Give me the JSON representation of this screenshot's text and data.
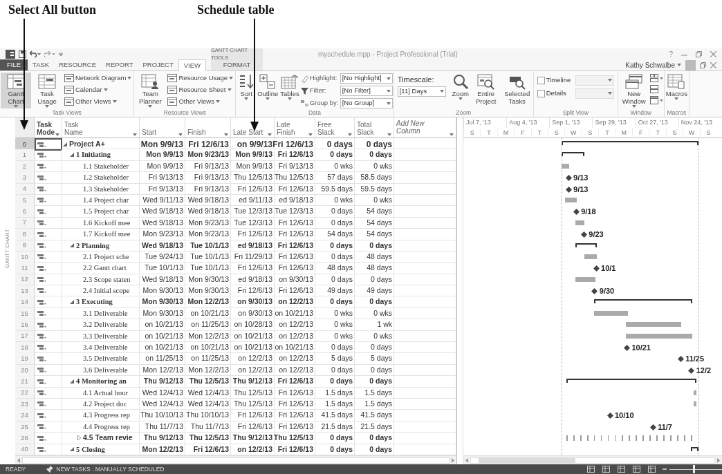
{
  "annotations": [
    {
      "text": "Select All button"
    },
    {
      "text": "Schedule table"
    }
  ],
  "title_bar": {
    "contextual": "GANTT CHART TOOLS",
    "title": "myschedule.mpp - Project Professional (Trial)",
    "help": "?"
  },
  "tabs": [
    {
      "label": "FILE",
      "kind": "file",
      "selected": false
    },
    {
      "label": "TASK",
      "kind": "tab",
      "selected": false
    },
    {
      "label": "RESOURCE",
      "kind": "tab",
      "selected": false
    },
    {
      "label": "REPORT",
      "kind": "tab",
      "selected": false
    },
    {
      "label": "PROJECT",
      "kind": "tab",
      "selected": false
    },
    {
      "label": "VIEW",
      "kind": "tab",
      "selected": true
    },
    {
      "label": "FORMAT",
      "kind": "contextual",
      "selected": false
    }
  ],
  "user": {
    "name": "Kathy Schwalbe"
  },
  "ribbon": [
    {
      "label": "Task Views",
      "columns": [
        {
          "kind": "large",
          "label": "Gantt Chart",
          "dropdown": true,
          "selected": true
        },
        {
          "kind": "large",
          "label": "Task Usage",
          "dropdown": true,
          "selected": false
        },
        {
          "kind": "stack",
          "items": [
            {
              "label": "Network Diagram",
              "dropdown": true,
              "selected": false
            },
            {
              "label": "Calendar",
              "dropdown": true,
              "selected": false
            },
            {
              "label": "Other Views",
              "dropdown": true,
              "selected": false
            }
          ]
        }
      ]
    },
    {
      "label": "Resource Views",
      "columns": [
        {
          "kind": "large",
          "label": "Team Planner",
          "dropdown": true,
          "selected": false
        },
        {
          "kind": "stack",
          "items": [
            {
              "label": "Resource Usage",
              "dropdown": true,
              "selected": false
            },
            {
              "label": "Resource Sheet",
              "dropdown": true,
              "selected": false
            },
            {
              "label": "Other Views",
              "dropdown": true,
              "selected": false
            }
          ]
        }
      ]
    },
    {
      "label": "Data",
      "columns": [
        {
          "kind": "large",
          "label": "Sort",
          "dropdown": true
        },
        {
          "kind": "large",
          "label": "Outline",
          "dropdown": true
        },
        {
          "kind": "large",
          "label": "Tables",
          "dropdown": true
        },
        {
          "kind": "fields",
          "items": [
            {
              "label": "Highlight:",
              "value": "[No Highlight]"
            },
            {
              "label": "Filter:",
              "value": "[No Filter]"
            },
            {
              "label": "Group by:",
              "value": "[No Group]"
            }
          ]
        }
      ]
    },
    {
      "label": "Zoom",
      "columns": [
        {
          "kind": "timescale",
          "label": "Timescale:",
          "value": "[11] Days"
        },
        {
          "kind": "large",
          "label": "Zoom",
          "dropdown": true
        },
        {
          "kind": "large",
          "label": "Entire Project",
          "dropdown": false
        },
        {
          "kind": "large",
          "label": "Selected Tasks",
          "dropdown": false
        }
      ]
    },
    {
      "label": "Split View",
      "columns": [
        {
          "kind": "checks",
          "items": [
            {
              "label": "Timeline",
              "checked": false
            },
            {
              "label": "Details",
              "checked": false
            }
          ]
        }
      ]
    },
    {
      "label": "Window",
      "columns": [
        {
          "kind": "large",
          "label": "New Window",
          "dropdown": true
        },
        {
          "kind": "icons",
          "items": [
            {
              "dropdown": true
            },
            {
              "dropdown": false
            },
            {
              "dropdown": true
            }
          ]
        }
      ]
    },
    {
      "label": "Macros",
      "columns": [
        {
          "kind": "large",
          "label": "Macros",
          "dropdown": true
        }
      ]
    }
  ],
  "view_label": "GANTT CHART",
  "columns": [
    {
      "label": "Task Mode",
      "kind": "mode"
    },
    {
      "label": "Task Name",
      "kind": "field"
    },
    {
      "label": "Start",
      "kind": "field"
    },
    {
      "label": "Finish",
      "kind": "field"
    },
    {
      "label": "Late Start",
      "kind": "field"
    },
    {
      "label": "Late Finish",
      "kind": "field"
    },
    {
      "label": "Free Slack",
      "kind": "field"
    },
    {
      "label": "Total Slack",
      "kind": "field"
    },
    {
      "label": "Add New Column",
      "kind": "add"
    }
  ],
  "tasks": [
    {
      "id": "0",
      "name": "Project A+",
      "start": "Mon 9/9/13",
      "finish": "Fri 12/6/13",
      "late_start": "on 9/9/13",
      "late_finish": "Fri 12/6/13",
      "free_slack": "0 days",
      "total_slack": "0 days",
      "kind": "summary",
      "expanded": true,
      "selected": true,
      "children": [
        {
          "id": "1",
          "name": "1 Initiating",
          "start": "Mon 9/9/13",
          "finish": "Mon 9/23/13",
          "late_start": "Mon 9/9/13",
          "late_finish": "Fri 12/6/13",
          "free_slack": "0 days",
          "total_slack": "0 days",
          "kind": "summary",
          "expanded": true,
          "selected": false,
          "children": [
            {
              "id": "2",
              "name": "1.1 Stakeholder",
              "start": "Mon 9/9/13",
              "finish": "Fri 9/13/13",
              "late_start": "Mon 9/9/13",
              "late_finish": "Fri 9/13/13",
              "free_slack": "0 wks",
              "total_slack": "0 wks",
              "kind": "task",
              "selected": false
            },
            {
              "id": "3",
              "name": "1.2 Stakeholder",
              "start": "Fri 9/13/13",
              "finish": "Fri 9/13/13",
              "late_start": "Thu 12/5/13",
              "late_finish": "Thu 12/5/13",
              "free_slack": "57 days",
              "total_slack": "58.5 days",
              "kind": "milestone",
              "gantt_label": "9/13",
              "selected": false
            },
            {
              "id": "4",
              "name": "1.3 Stakeholder",
              "start": "Fri 9/13/13",
              "finish": "Fri 9/13/13",
              "late_start": "Fri 12/6/13",
              "late_finish": "Fri 12/6/13",
              "free_slack": "59.5 days",
              "total_slack": "59.5 days",
              "kind": "milestone",
              "gantt_label": "9/13",
              "selected": false
            },
            {
              "id": "5",
              "name": "1.4 Project char",
              "start": "Wed 9/11/13",
              "finish": "Wed 9/18/13",
              "late_start": "ed 9/11/13",
              "late_finish": "ed 9/18/13",
              "free_slack": "0 wks",
              "total_slack": "0 wks",
              "kind": "task",
              "selected": false
            },
            {
              "id": "6",
              "name": "1.5 Project char",
              "start": "Wed 9/18/13",
              "finish": "Wed 9/18/13",
              "late_start": "Tue 12/3/13",
              "late_finish": "Tue 12/3/13",
              "free_slack": "0 days",
              "total_slack": "54 days",
              "kind": "milestone",
              "gantt_label": "9/18",
              "selected": false
            },
            {
              "id": "7",
              "name": "1.6 Kickoff mee",
              "start": "Wed 9/18/13",
              "finish": "Mon 9/23/13",
              "late_start": "Tue 12/3/13",
              "late_finish": "Fri 12/6/13",
              "free_slack": "0 days",
              "total_slack": "54 days",
              "kind": "task",
              "selected": false
            },
            {
              "id": "8",
              "name": "1.7 Kickoff mee",
              "start": "Mon 9/23/13",
              "finish": "Mon 9/23/13",
              "late_start": "Fri 12/6/13",
              "late_finish": "Fri 12/6/13",
              "free_slack": "54 days",
              "total_slack": "54 days",
              "kind": "milestone",
              "gantt_label": "9/23",
              "selected": false
            }
          ]
        },
        {
          "id": "9",
          "name": "2 Planning",
          "start": "Wed 9/18/13",
          "finish": "Tue 10/1/13",
          "late_start": "ed 9/18/13",
          "late_finish": "Fri 12/6/13",
          "free_slack": "0 days",
          "total_slack": "0 days",
          "kind": "summary",
          "expanded": true,
          "selected": false,
          "children": [
            {
              "id": "10",
              "name": "2.1 Project sche",
              "start": "Tue 9/24/13",
              "finish": "Tue 10/1/13",
              "late_start": "Fri 11/29/13",
              "late_finish": "Fri 12/6/13",
              "free_slack": "0 days",
              "total_slack": "48 days",
              "kind": "task",
              "selected": false
            },
            {
              "id": "11",
              "name": "2.2 Gantt chart",
              "start": "Tue 10/1/13",
              "finish": "Tue 10/1/13",
              "late_start": "Fri 12/6/13",
              "late_finish": "Fri 12/6/13",
              "free_slack": "48 days",
              "total_slack": "48 days",
              "kind": "milestone",
              "gantt_label": "10/1",
              "selected": false
            },
            {
              "id": "12",
              "name": "2.3 Scope staten",
              "start": "Wed 9/18/13",
              "finish": "Mon 9/30/13",
              "late_start": "ed 9/18/13",
              "late_finish": "on 9/30/13",
              "free_slack": "0 days",
              "total_slack": "0 days",
              "kind": "task",
              "selected": false
            },
            {
              "id": "13",
              "name": "2.4 Initial scope",
              "start": "Mon 9/30/13",
              "finish": "Mon 9/30/13",
              "late_start": "Fri 12/6/13",
              "late_finish": "Fri 12/6/13",
              "free_slack": "49 days",
              "total_slack": "49 days",
              "kind": "milestone",
              "gantt_label": "9/30",
              "selected": false
            }
          ]
        },
        {
          "id": "14",
          "name": "3 Executing",
          "start": "Mon 9/30/13",
          "finish": "Mon 12/2/13",
          "late_start": "on 9/30/13",
          "late_finish": "on 12/2/13",
          "free_slack": "0 days",
          "total_slack": "0 days",
          "kind": "summary",
          "expanded": true,
          "selected": false,
          "children": [
            {
              "id": "15",
              "name": "3.1 Deliverable",
              "start": "Mon 9/30/13",
              "finish": "on 10/21/13",
              "late_start": "on 9/30/13",
              "late_finish": "on 10/21/13",
              "free_slack": "0 wks",
              "total_slack": "0 wks",
              "kind": "task",
              "selected": false
            },
            {
              "id": "16",
              "name": "3.2 Deliverable",
              "start": "on 10/21/13",
              "finish": "on 11/25/13",
              "late_start": "on 10/28/13",
              "late_finish": "on 12/2/13",
              "free_slack": "0 wks",
              "total_slack": "1 wk",
              "kind": "task",
              "selected": false
            },
            {
              "id": "17",
              "name": "3.3 Deliverable",
              "start": "on 10/21/13",
              "finish": "Mon 12/2/13",
              "late_start": "on 10/21/13",
              "late_finish": "on 12/2/13",
              "free_slack": "0 wks",
              "total_slack": "0 wks",
              "kind": "task",
              "selected": false
            },
            {
              "id": "18",
              "name": "3.4 Deliverable",
              "start": "on 10/21/13",
              "finish": "on 10/21/13",
              "late_start": "on 10/21/13",
              "late_finish": "on 10/21/13",
              "free_slack": "0 days",
              "total_slack": "0 days",
              "kind": "milestone",
              "gantt_label": "10/21",
              "selected": false
            },
            {
              "id": "19",
              "name": "3.5 Deliverable",
              "start": "on 11/25/13",
              "finish": "on 11/25/13",
              "late_start": "on 12/2/13",
              "late_finish": "on 12/2/13",
              "free_slack": "5 days",
              "total_slack": "5 days",
              "kind": "milestone",
              "gantt_label": "11/25",
              "selected": false
            },
            {
              "id": "20",
              "name": "3.6 Deliverable",
              "start": "Mon 12/2/13",
              "finish": "Mon 12/2/13",
              "late_start": "on 12/2/13",
              "late_finish": "on 12/2/13",
              "free_slack": "0 days",
              "total_slack": "0 days",
              "kind": "milestone",
              "gantt_label": "12/2",
              "selected": false
            }
          ]
        },
        {
          "id": "21",
          "name": "4 Monitoring an",
          "start": "Thu 9/12/13",
          "finish": "Thu 12/5/13",
          "late_start": "Thu 9/12/13",
          "late_finish": "Fri 12/6/13",
          "free_slack": "0 days",
          "total_slack": "0 days",
          "kind": "summary",
          "expanded": true,
          "selected": false,
          "children": [
            {
              "id": "22",
              "name": "4.1 Actual hour",
              "start": "Wed 12/4/13",
              "finish": "Wed 12/4/13",
              "late_start": "Thu 12/5/13",
              "late_finish": "Fri 12/6/13",
              "free_slack": "1.5 days",
              "total_slack": "1.5 days",
              "kind": "task",
              "selected": false
            },
            {
              "id": "23",
              "name": "4.2 Project doc",
              "start": "Wed 12/4/13",
              "finish": "Wed 12/4/13",
              "late_start": "Thu 12/5/13",
              "late_finish": "Fri 12/6/13",
              "free_slack": "1.5 days",
              "total_slack": "1.5 days",
              "kind": "task",
              "selected": false
            },
            {
              "id": "24",
              "name": "4.3 Progress rep",
              "start": "Thu 10/10/13",
              "finish": "Thu 10/10/13",
              "late_start": "Fri 12/6/13",
              "late_finish": "Fri 12/6/13",
              "free_slack": "41.5 days",
              "total_slack": "41.5 days",
              "kind": "milestone",
              "gantt_label": "10/10",
              "selected": false
            },
            {
              "id": "25",
              "name": "4.4 Progress rep",
              "start": "Thu 11/7/13",
              "finish": "Thu 11/7/13",
              "late_start": "Fri 12/6/13",
              "late_finish": "Fri 12/6/13",
              "free_slack": "21.5 days",
              "total_slack": "21.5 days",
              "kind": "milestone",
              "gantt_label": "11/7",
              "selected": false
            },
            {
              "id": "26",
              "name": "4.5 Team revie",
              "start": "Thu 9/12/13",
              "finish": "Thu 12/5/13",
              "late_start": "Thu 9/12/13",
              "late_finish": "Thu 12/5/13",
              "free_slack": "0 days",
              "total_slack": "0 days",
              "kind": "summary",
              "expanded": false,
              "selected": false
            }
          ]
        },
        {
          "id": "40",
          "name": "5 Closing",
          "start": "Mon 12/2/13",
          "finish": "Fri 12/6/13",
          "late_start": "on 12/2/13",
          "late_finish": "Fri 12/6/13",
          "free_slack": "0 days",
          "total_slack": "0 days",
          "kind": "summary",
          "expanded": true,
          "selected": false
        }
      ]
    }
  ],
  "timescale": {
    "major": [
      "Jul 7, '13",
      "Aug 4, '13",
      "Sep 1, '13",
      "Sep 29, '13",
      "Oct 27, '13",
      "Nov 24, '13"
    ],
    "minor": [
      "S",
      "T",
      "M",
      "F",
      "T",
      "S",
      "W",
      "S",
      "T",
      "M",
      "F",
      "T",
      "S",
      "W",
      "S"
    ]
  },
  "status_bar": {
    "status": "READY",
    "new_tasks": "NEW TASKS : MANUALLY SCHEDULED",
    "zoom": {
      "level": 0.45
    }
  }
}
